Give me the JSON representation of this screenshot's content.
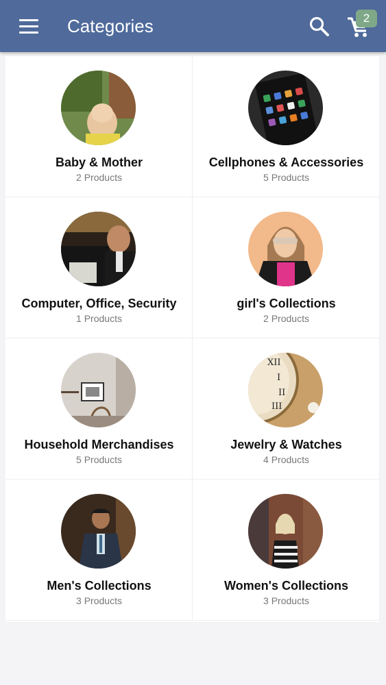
{
  "header": {
    "title": "Categories",
    "cart_count": "2",
    "bar_color": "#4f6a9b",
    "badge_color": "#7ea888"
  },
  "categories": [
    {
      "name": "Baby & Mother",
      "count": "2 Products",
      "image": "baby-photo"
    },
    {
      "name": "Cellphones & Accessories",
      "count": "5 Products",
      "image": "phone-photo"
    },
    {
      "name": "Computer, Office, Security",
      "count": "1 Products",
      "image": "office-photo"
    },
    {
      "name": "girl's Collections",
      "count": "2 Products",
      "image": "girl-photo"
    },
    {
      "name": "Household Merchandises",
      "count": "5 Products",
      "image": "room-photo"
    },
    {
      "name": "Jewelry & Watches",
      "count": "4 Products",
      "image": "watch-photo"
    },
    {
      "name": "Men's Collections",
      "count": "3 Products",
      "image": "man-photo"
    },
    {
      "name": "Women's Collections",
      "count": "3 Products",
      "image": "woman-photo"
    }
  ]
}
